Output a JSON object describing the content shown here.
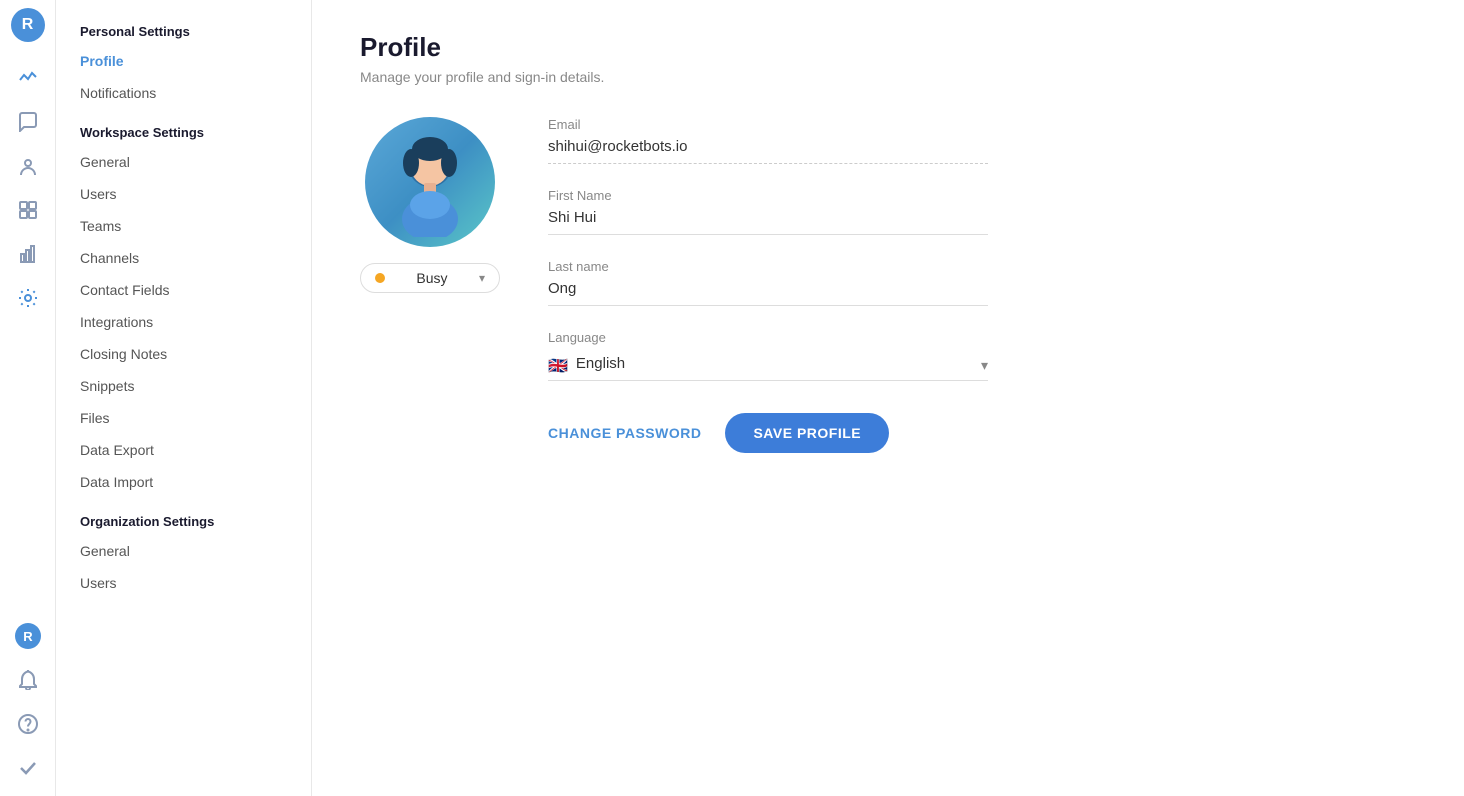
{
  "app": {
    "user_initial": "R",
    "user_avatar_color": "#4a90d9"
  },
  "sidebar": {
    "personal_settings_title": "Personal Settings",
    "profile_label": "Profile",
    "notifications_label": "Notifications",
    "workspace_settings_title": "Workspace Settings",
    "general_label": "General",
    "users_label": "Users",
    "teams_label": "Teams",
    "channels_label": "Channels",
    "contact_fields_label": "Contact Fields",
    "integrations_label": "Integrations",
    "closing_notes_label": "Closing Notes",
    "snippets_label": "Snippets",
    "files_label": "Files",
    "data_export_label": "Data Export",
    "data_import_label": "Data Import",
    "organization_settings_title": "Organization Settings",
    "org_general_label": "General",
    "org_users_label": "Users"
  },
  "page": {
    "title": "Profile",
    "subtitle": "Manage your profile and sign-in details."
  },
  "profile": {
    "status": {
      "label": "Busy",
      "color": "#f5a623"
    },
    "email_label": "Email",
    "email_value": "shihui@rocketbots.io",
    "first_name_label": "First Name",
    "first_name_value": "Shi Hui",
    "last_name_label": "Last name",
    "last_name_value": "Ong",
    "language_label": "Language",
    "language_value": "English",
    "language_flag": "🇬🇧",
    "change_password_label": "CHANGE PASSWORD",
    "save_profile_label": "SAVE PROFILE"
  },
  "icons": {
    "activity": "◎",
    "chat": "💬",
    "contacts": "👤",
    "integrations": "⚡",
    "reports": "📊",
    "settings": "⚙",
    "notification": "🔔",
    "help": "❓",
    "checkmark": "✔"
  }
}
